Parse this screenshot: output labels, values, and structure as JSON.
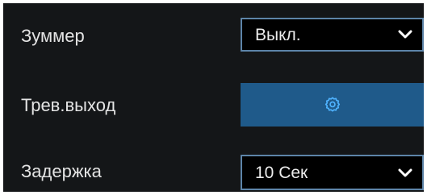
{
  "rows": {
    "buzzer": {
      "label": "Зуммер",
      "value": "Выкл."
    },
    "alarm_output": {
      "label": "Трев.выход",
      "button_icon": "gear-icon"
    },
    "delay": {
      "label": "Задержка",
      "value": "10 Сек"
    }
  },
  "colors": {
    "background": "#141618",
    "field_background": "#000000",
    "field_border": "#5d84a8",
    "button_background": "#1f5a8a",
    "icon_color": "#4fb3ff",
    "text": "#e4e4e4"
  }
}
